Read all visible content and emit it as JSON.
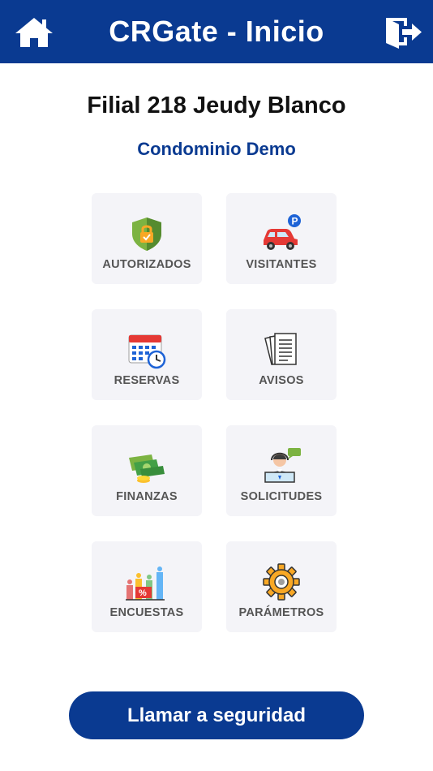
{
  "header": {
    "title": "CRGate - Inicio",
    "home_icon": "home-icon",
    "logout_icon": "logout-icon",
    "background_color": "#0a3a91"
  },
  "subsidiary": "Filial 218 Jeudy Blanco",
  "condominium": "Condominio Demo",
  "menu": {
    "items": [
      {
        "label": "AUTORIZADOS",
        "icon": "shield-check-icon"
      },
      {
        "label": "VISITANTES",
        "icon": "car-parking-icon"
      },
      {
        "label": "RESERVAS",
        "icon": "calendar-clock-icon"
      },
      {
        "label": "AVISOS",
        "icon": "documents-icon"
      },
      {
        "label": "FINANZAS",
        "icon": "money-icon"
      },
      {
        "label": "SOLICITUDES",
        "icon": "support-agent-icon"
      },
      {
        "label": "ENCUESTAS",
        "icon": "survey-chart-icon"
      },
      {
        "label": "PARÁMETROS",
        "icon": "gear-icon"
      }
    ]
  },
  "call_button": "Llamar a seguridad",
  "colors": {
    "brand": "#0a3a91",
    "tile_bg": "#f4f4f8",
    "label": "#555555"
  }
}
